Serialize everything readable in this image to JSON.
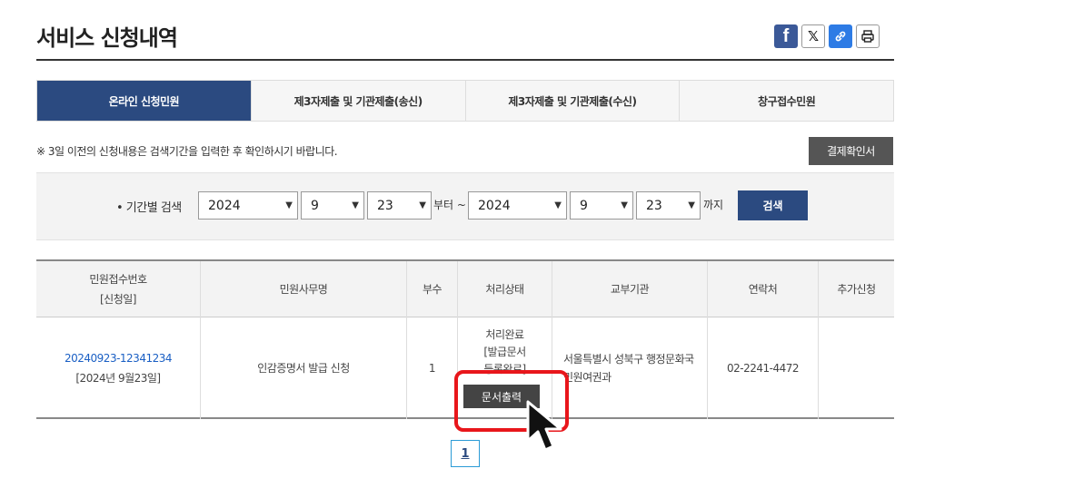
{
  "header": {
    "title": "서비스 신청내역",
    "share": {
      "facebook": "f",
      "x": "𝕏",
      "link": "🔗",
      "print": "⎙"
    }
  },
  "tabs": [
    {
      "label": "온라인 신청민원",
      "active": true
    },
    {
      "label": "제3자제출 및 기관제출(송신)",
      "active": false
    },
    {
      "label": "제3자제출 및 기관제출(수신)",
      "active": false
    },
    {
      "label": "창구접수민원",
      "active": false
    }
  ],
  "notice": "※ 3일 이전의 신청내용은 검색기간을 입력한 후 확인하시기 바랍니다.",
  "confirm_button": "결제확인서",
  "search": {
    "label": "• 기간별 검색",
    "from": {
      "year": "2024",
      "month": "9",
      "day": "23"
    },
    "from_suffix": "부터 ~",
    "to": {
      "year": "2024",
      "month": "9",
      "day": "23"
    },
    "to_suffix": "까지",
    "button": "검색"
  },
  "table": {
    "headers": {
      "receipt_line1": "민원접수번호",
      "receipt_line2": "[신청일]",
      "service": "민원사무명",
      "copies": "부수",
      "status": "처리상태",
      "agency": "교부기관",
      "contact": "연락처",
      "extra": "추가신청"
    },
    "rows": [
      {
        "receipt_no": "20240923-12341234",
        "receipt_date": "[2024년 9월23일]",
        "service": "인감증명서 발급 신청",
        "copies": "1",
        "status_line1": "처리완료",
        "status_line2": "[발급문서",
        "status_line3": "등록완료]",
        "agency_line1": "서울특별시 성북구 행정문화국",
        "agency_line2": "민원여권과",
        "contact": "02-2241-4472",
        "print_button": "문서출력"
      }
    ]
  },
  "pagination": {
    "current": "1"
  },
  "colors": {
    "accent": "#2b4a80",
    "highlight": "#e8161b",
    "link": "#1a5fc4"
  }
}
